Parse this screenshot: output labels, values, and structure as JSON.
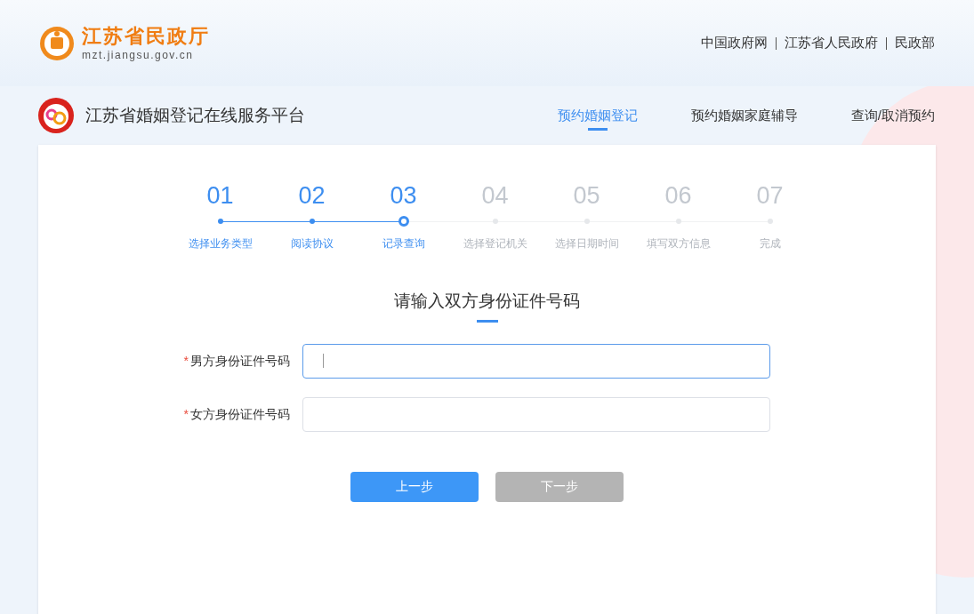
{
  "header": {
    "site_name": "江苏省民政厅",
    "site_url": "mzt.jiangsu.gov.cn",
    "links": [
      "中国政府网",
      "江苏省人民政府",
      "民政部"
    ]
  },
  "platform": {
    "title": "江苏省婚姻登记在线服务平台",
    "nav": [
      {
        "label": "预约婚姻登记",
        "selected": true
      },
      {
        "label": "预约婚姻家庭辅导",
        "selected": false
      },
      {
        "label": "查询/取消预约",
        "selected": false
      }
    ]
  },
  "steps": [
    {
      "number": "01",
      "label": "选择业务类型",
      "done": true,
      "current": false
    },
    {
      "number": "02",
      "label": "阅读协议",
      "done": true,
      "current": false
    },
    {
      "number": "03",
      "label": "记录查询",
      "done": true,
      "current": true
    },
    {
      "number": "04",
      "label": "选择登记机关",
      "done": false,
      "current": false
    },
    {
      "number": "05",
      "label": "选择日期时间",
      "done": false,
      "current": false
    },
    {
      "number": "06",
      "label": "填写双方信息",
      "done": false,
      "current": false
    },
    {
      "number": "07",
      "label": "完成",
      "done": false,
      "current": false
    }
  ],
  "form": {
    "title": "请输入双方身份证件号码",
    "fields": [
      {
        "required_mark": "*",
        "label": "男方身份证件号码",
        "focused": true
      },
      {
        "required_mark": "*",
        "label": "女方身份证件号码",
        "focused": false
      }
    ]
  },
  "buttons": [
    {
      "label": "上一步",
      "disabled": false
    },
    {
      "label": "下一步",
      "disabled": true
    }
  ]
}
